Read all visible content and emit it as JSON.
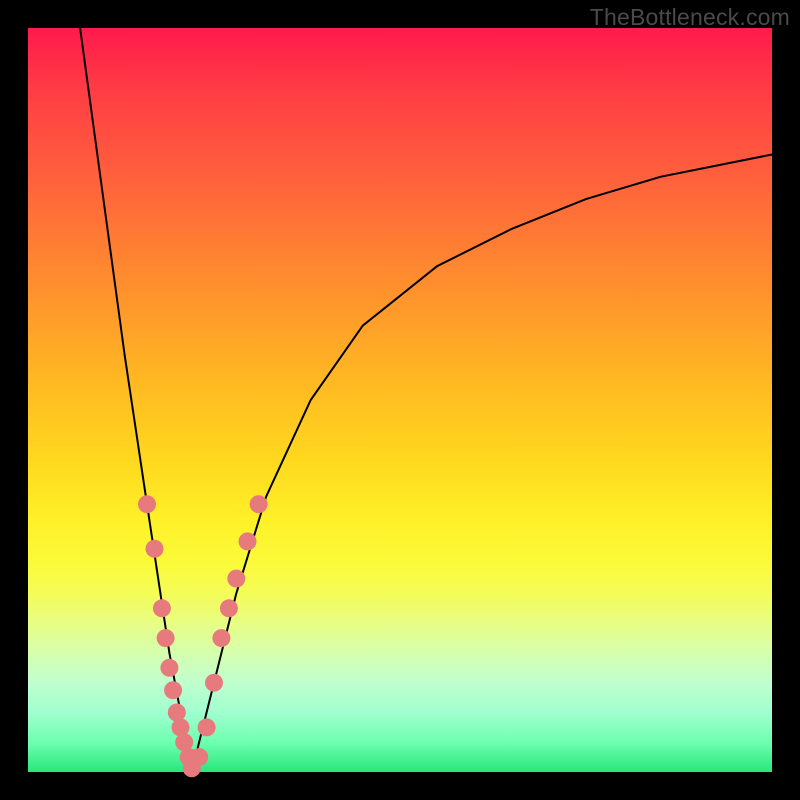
{
  "watermark": "TheBottleneck.com",
  "colors": {
    "background_frame": "#000000",
    "gradient_top": "#ff1a4d",
    "gradient_bottom": "#28e77a",
    "curve_stroke": "#000000",
    "marker_fill": "#e77a7d"
  },
  "chart_data": {
    "type": "line",
    "title": "",
    "xlabel": "",
    "ylabel": "",
    "xlim": [
      0,
      100
    ],
    "ylim": [
      0,
      100
    ],
    "notes": "Unlabeled V-shaped bottleneck curve over red→green vertical gradient. Percent axes inferred (0–100). Minimum near x≈22, y≈0. Left branch rises to top edge near x≈7; right branch rises asymptotically toward ~y≈83 at x=100.",
    "series": [
      {
        "name": "bottleneck-curve",
        "x": [
          7,
          10,
          13,
          16,
          19,
          22,
          25,
          28,
          32,
          38,
          45,
          55,
          65,
          75,
          85,
          100
        ],
        "y": [
          100,
          78,
          56,
          36,
          16,
          0,
          12,
          24,
          37,
          50,
          60,
          68,
          73,
          77,
          80,
          83
        ]
      }
    ],
    "markers": {
      "name": "highlighted-points",
      "note": "Salmon dots clustered near the trough of the V on both branches.",
      "points": [
        {
          "x": 16,
          "y": 36
        },
        {
          "x": 17,
          "y": 30
        },
        {
          "x": 18,
          "y": 22
        },
        {
          "x": 18.5,
          "y": 18
        },
        {
          "x": 19,
          "y": 14
        },
        {
          "x": 19.5,
          "y": 11
        },
        {
          "x": 20,
          "y": 8
        },
        {
          "x": 20.5,
          "y": 6
        },
        {
          "x": 21,
          "y": 4
        },
        {
          "x": 21.6,
          "y": 2
        },
        {
          "x": 22,
          "y": 0.5
        },
        {
          "x": 23,
          "y": 2
        },
        {
          "x": 24,
          "y": 6
        },
        {
          "x": 25,
          "y": 12
        },
        {
          "x": 26,
          "y": 18
        },
        {
          "x": 27,
          "y": 22
        },
        {
          "x": 28,
          "y": 26
        },
        {
          "x": 29.5,
          "y": 31
        },
        {
          "x": 31,
          "y": 36
        }
      ]
    }
  }
}
